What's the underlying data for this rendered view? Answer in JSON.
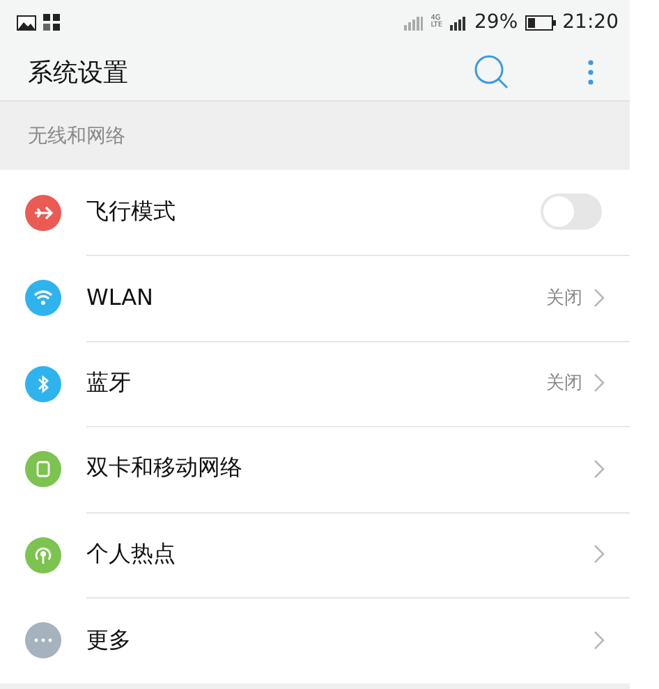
{
  "status_bar": {
    "network_top": "4G",
    "network_bottom": "LTE",
    "battery": "29%",
    "time": "21:20"
  },
  "app_bar": {
    "title": "系统设置"
  },
  "section": {
    "title": "无线和网络"
  },
  "items": [
    {
      "kind": "toggle",
      "label": "飞行模式",
      "color": "#ea5b54",
      "on": false
    },
    {
      "kind": "link",
      "label": "WLAN",
      "value": "关闭",
      "color": "#2fb3ee"
    },
    {
      "kind": "link",
      "label": "蓝牙",
      "value": "关闭",
      "color": "#2fb3ee"
    },
    {
      "kind": "link",
      "label": "双卡和移动网络",
      "color": "#7cc34f"
    },
    {
      "kind": "link",
      "label": "个人热点",
      "color": "#7cc34f"
    },
    {
      "kind": "link",
      "label": "更多",
      "color": "#a6b2bd"
    }
  ]
}
